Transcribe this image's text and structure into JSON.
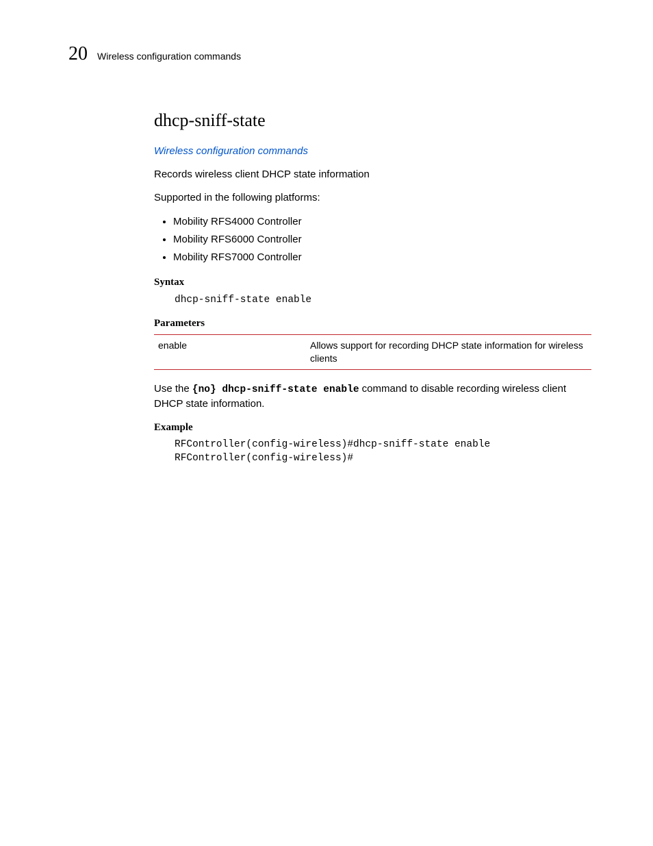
{
  "header": {
    "page_number": "20",
    "running_title": "Wireless configuration commands"
  },
  "title": "dhcp-sniff-state",
  "breadcrumb": "Wireless configuration commands",
  "description": "Records wireless client DHCP state information",
  "supported_intro": "Supported in the following platforms:",
  "platforms": [
    "Mobility RFS4000 Controller",
    "Mobility RFS6000 Controller",
    "Mobility RFS7000 Controller"
  ],
  "syntax": {
    "label": "Syntax",
    "code": "dhcp-sniff-state enable"
  },
  "parameters": {
    "label": "Parameters",
    "rows": [
      {
        "name": "enable",
        "desc": "Allows support for recording DHCP state information for wireless clients"
      }
    ]
  },
  "usage": {
    "prefix": "Use the ",
    "code": "{no} dhcp-sniff-state enable",
    "suffix": " command to disable recording wireless client DHCP state information."
  },
  "example": {
    "label": "Example",
    "code": "RFController(config-wireless)#dhcp-sniff-state enable\nRFController(config-wireless)#"
  }
}
